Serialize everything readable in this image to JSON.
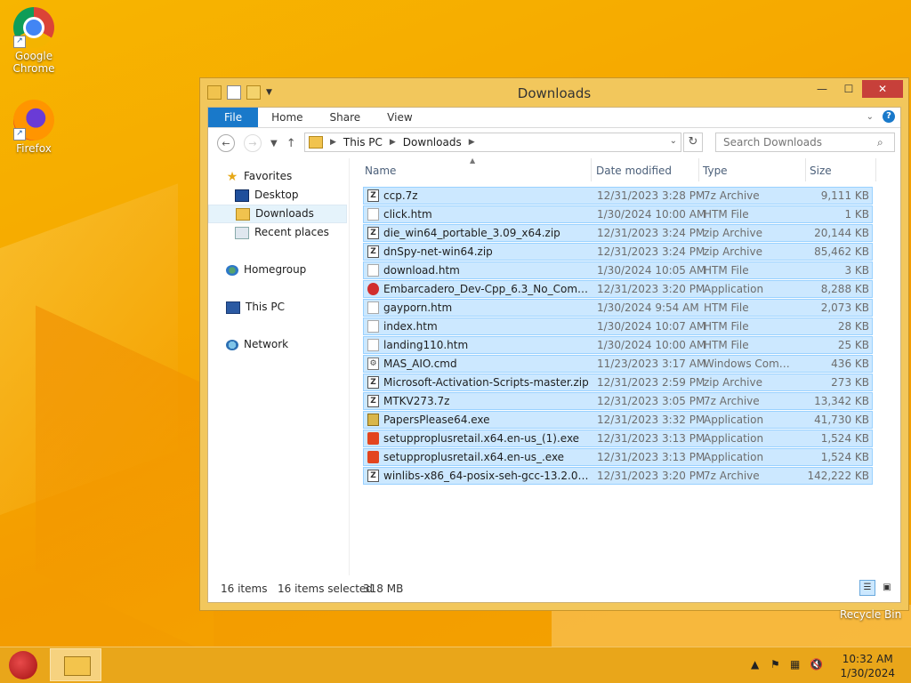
{
  "desktop": {
    "icons": [
      {
        "label": "Google Chrome",
        "icon": "chrome-icon"
      },
      {
        "label": "Firefox",
        "icon": "firefox-icon"
      }
    ],
    "recycle_bin_label": "Recycle Bin"
  },
  "window": {
    "title": "Downloads",
    "controls": {
      "minimize": "—",
      "maximize": "☐",
      "close": "✕"
    }
  },
  "ribbon": {
    "tabs": [
      "File",
      "Home",
      "Share",
      "View"
    ]
  },
  "navigation": {
    "breadcrumb": [
      "This PC",
      "Downloads"
    ],
    "search_placeholder": "Search Downloads"
  },
  "nav_pane": {
    "favorites_label": "Favorites",
    "favorites": [
      "Desktop",
      "Downloads",
      "Recent places"
    ],
    "selected": "Downloads",
    "homegroup_label": "Homegroup",
    "this_pc_label": "This PC",
    "network_label": "Network"
  },
  "columns": [
    "Name",
    "Date modified",
    "Type",
    "Size"
  ],
  "files": [
    {
      "name": "ccp.7z",
      "date": "12/31/2023 3:28 PM",
      "type": "7z Archive",
      "size": "9,111 KB",
      "icon": "zip"
    },
    {
      "name": "click.htm",
      "date": "1/30/2024 10:00 AM",
      "type": "HTM File",
      "size": "1 KB",
      "icon": "htm"
    },
    {
      "name": "die_win64_portable_3.09_x64.zip",
      "date": "12/31/2023 3:24 PM",
      "type": "zip Archive",
      "size": "20,144 KB",
      "icon": "zip"
    },
    {
      "name": "dnSpy-net-win64.zip",
      "date": "12/31/2023 3:24 PM",
      "type": "zip Archive",
      "size": "85,462 KB",
      "icon": "zip"
    },
    {
      "name": "download.htm",
      "date": "1/30/2024 10:05 AM",
      "type": "HTM File",
      "size": "3 KB",
      "icon": "htm"
    },
    {
      "name": "Embarcadero_Dev-Cpp_6.3_No_Compiler...",
      "date": "12/31/2023 3:20 PM",
      "type": "Application",
      "size": "8,288 KB",
      "icon": "app-red"
    },
    {
      "name": "gayporn.htm",
      "date": "1/30/2024 9:54 AM",
      "type": "HTM File",
      "size": "2,073 KB",
      "icon": "htm"
    },
    {
      "name": "index.htm",
      "date": "1/30/2024 10:07 AM",
      "type": "HTM File",
      "size": "28 KB",
      "icon": "htm"
    },
    {
      "name": "landing110.htm",
      "date": "1/30/2024 10:00 AM",
      "type": "HTM File",
      "size": "25 KB",
      "icon": "htm"
    },
    {
      "name": "MAS_AIO.cmd",
      "date": "11/23/2023 3:17 AM",
      "type": "Windows Comma...",
      "size": "436 KB",
      "icon": "cmd"
    },
    {
      "name": "Microsoft-Activation-Scripts-master.zip",
      "date": "12/31/2023 2:59 PM",
      "type": "zip Archive",
      "size": "273 KB",
      "icon": "zip"
    },
    {
      "name": "MTKV273.7z",
      "date": "12/31/2023 3:05 PM",
      "type": "7z Archive",
      "size": "13,342 KB",
      "icon": "zip"
    },
    {
      "name": "PapersPlease64.exe",
      "date": "12/31/2023 3:32 PM",
      "type": "Application",
      "size": "41,730 KB",
      "icon": "app-pp"
    },
    {
      "name": "setupproplusretail.x64.en-us_(1).exe",
      "date": "12/31/2023 3:13 PM",
      "type": "Application",
      "size": "1,524 KB",
      "icon": "office"
    },
    {
      "name": "setupproplusretail.x64.en-us_.exe",
      "date": "12/31/2023 3:13 PM",
      "type": "Application",
      "size": "1,524 KB",
      "icon": "office"
    },
    {
      "name": "winlibs-x86_64-posix-seh-gcc-13.2.0-llv...",
      "date": "12/31/2023 3:20 PM",
      "type": "7z Archive",
      "size": "142,222 KB",
      "icon": "zip"
    }
  ],
  "status": {
    "item_count": "16 items",
    "selection": "16 items selected",
    "selection_size": "318 MB"
  },
  "taskbar": {
    "time": "10:32 AM",
    "date": "1/30/2024"
  }
}
